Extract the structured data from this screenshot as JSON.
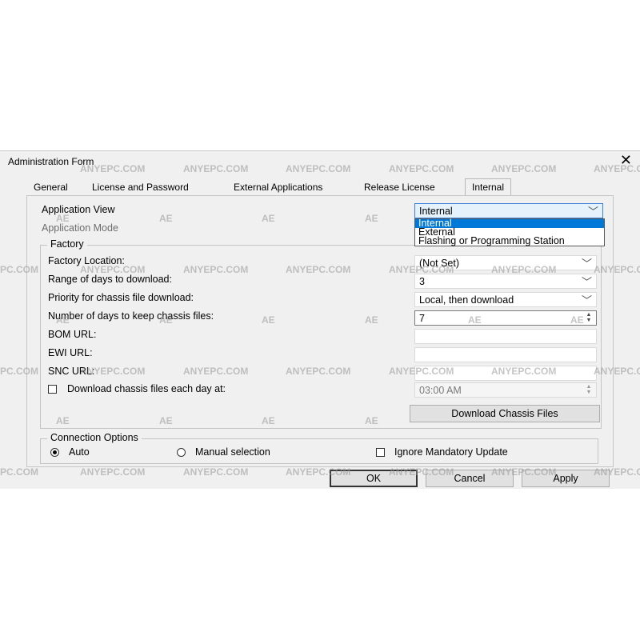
{
  "window": {
    "title": "Administration Form",
    "close_glyph": "✕"
  },
  "tabs": [
    "General",
    "License and Password",
    "External Applications",
    "Release License",
    "Internal"
  ],
  "internal": {
    "application_view_label": "Application View",
    "application_view_value": "Internal",
    "application_view_options": [
      "Internal",
      "External",
      "Flashing or Programming Station"
    ],
    "application_mode_label": "Application Mode"
  },
  "factory": {
    "group_title": "Factory",
    "location_label": "Factory Location:",
    "location_value": "(Not Set)",
    "range_label": "Range of days to download:",
    "range_value": "3",
    "priority_label": "Priority for chassis file download:",
    "priority_value": "Local, then download",
    "keep_label": "Number of days to keep chassis files:",
    "keep_value": "7",
    "bom_label": "BOM URL:",
    "bom_value": "",
    "ewi_label": "EWI URL:",
    "ewi_value": "",
    "snc_label": "SNC URL:",
    "snc_value": "",
    "daily_label": "Download chassis files each day at:",
    "daily_time": "03:00 AM",
    "download_button": "Download Chassis Files"
  },
  "connection": {
    "group_title": "Connection Options",
    "auto_label": "Auto",
    "manual_label": "Manual selection",
    "ignore_label": "Ignore Mandatory Update"
  },
  "buttons": {
    "ok": "OK",
    "cancel": "Cancel",
    "apply": "Apply"
  },
  "watermark": {
    "text": "ANYEPC.COM",
    "short": "PC.COM",
    "logo": "AE"
  }
}
